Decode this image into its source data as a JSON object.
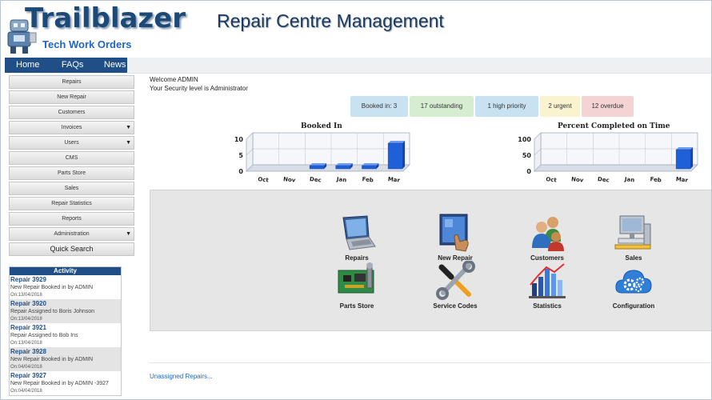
{
  "header": {
    "brand": "Trailblazer",
    "subbrand": "Tech Work Orders",
    "app_title": "Repair Centre Management"
  },
  "nav": {
    "items": [
      "Home",
      "FAQs",
      "News"
    ]
  },
  "sidebar": {
    "items": [
      {
        "label": "Repairs"
      },
      {
        "label": "New Repair"
      },
      {
        "label": "Customers"
      },
      {
        "label": "Invoices"
      },
      {
        "label": "Users"
      },
      {
        "label": "CMS"
      },
      {
        "label": "Parts Store"
      },
      {
        "label": "Sales"
      },
      {
        "label": "Repair Statistics"
      },
      {
        "label": "Reports"
      },
      {
        "label": "Administration"
      }
    ],
    "quick_search": "Quick Search"
  },
  "activity": {
    "header": "Activity",
    "items": [
      {
        "title": "Repair 3929",
        "desc": "New Repair Booked in by ADMIN",
        "date": "On:13/04/2018"
      },
      {
        "title": "Repair 3920",
        "desc": "Repair Assigned to Boris Johnson",
        "date": "On:13/04/2018"
      },
      {
        "title": "Repair 3921",
        "desc": "Repair Assigned to Bob Ins",
        "date": "On:13/04/2018"
      },
      {
        "title": "Repair 3928",
        "desc": "New Repair Booked in by ADMIN",
        "date": "On:04/04/2018"
      },
      {
        "title": "Repair 3927",
        "desc": "New Repair Booked in by ADMIN -3927",
        "date": "On:04/04/2018"
      }
    ]
  },
  "welcome": {
    "line1": "Welcome ADMIN",
    "line2": "Your Security level is Administrator"
  },
  "stats": [
    {
      "label": "Booked in: 3",
      "color": "#c9e2f2"
    },
    {
      "label": "17 outstanding",
      "color": "#d7edd2"
    },
    {
      "label": "1 high priority",
      "color": "#c9e2f2"
    },
    {
      "label": "2 urgent",
      "color": "#faf3cf"
    },
    {
      "label": "12 overdue",
      "color": "#f4d3d3"
    }
  ],
  "chart_data": [
    {
      "type": "bar",
      "title": "Booked In",
      "categories": [
        "Oct",
        "Nov",
        "Dec",
        "Jan",
        "Feb",
        "Mar"
      ],
      "values": [
        0,
        0,
        1,
        1,
        1,
        8
      ],
      "ylim": [
        0,
        10
      ],
      "yticks": [
        "10",
        "5",
        "0"
      ],
      "grid": true
    },
    {
      "type": "bar",
      "title": "Percent Completed on Time",
      "categories": [
        "Oct",
        "Nov",
        "Dec",
        "Jan",
        "Feb",
        "Mar"
      ],
      "values": [
        0,
        0,
        0,
        0,
        0,
        60
      ],
      "ylim": [
        0,
        100
      ],
      "yticks": [
        "100",
        "50",
        "0"
      ],
      "grid": true
    }
  ],
  "dashboard": {
    "tiles": [
      {
        "label": "Repairs",
        "icon": "laptop-icon"
      },
      {
        "label": "New Repair",
        "icon": "touchscreen-icon"
      },
      {
        "label": "Customers",
        "icon": "customers-icon"
      },
      {
        "label": "Sales",
        "icon": "sales-icon"
      },
      {
        "label": "Parts Store",
        "icon": "circuit-board-icon"
      },
      {
        "label": "Service Codes",
        "icon": "tools-icon"
      },
      {
        "label": "Statistics",
        "icon": "statistics-icon"
      },
      {
        "label": "Configuration",
        "icon": "cloud-gears-icon"
      }
    ]
  },
  "footer": {
    "unassigned_link": "Unassigned Repairs..."
  },
  "colors": {
    "brand": "#1c4a78",
    "nav": "#1f4f86",
    "link": "#1f66c8",
    "bar": "#1f5fd8"
  }
}
